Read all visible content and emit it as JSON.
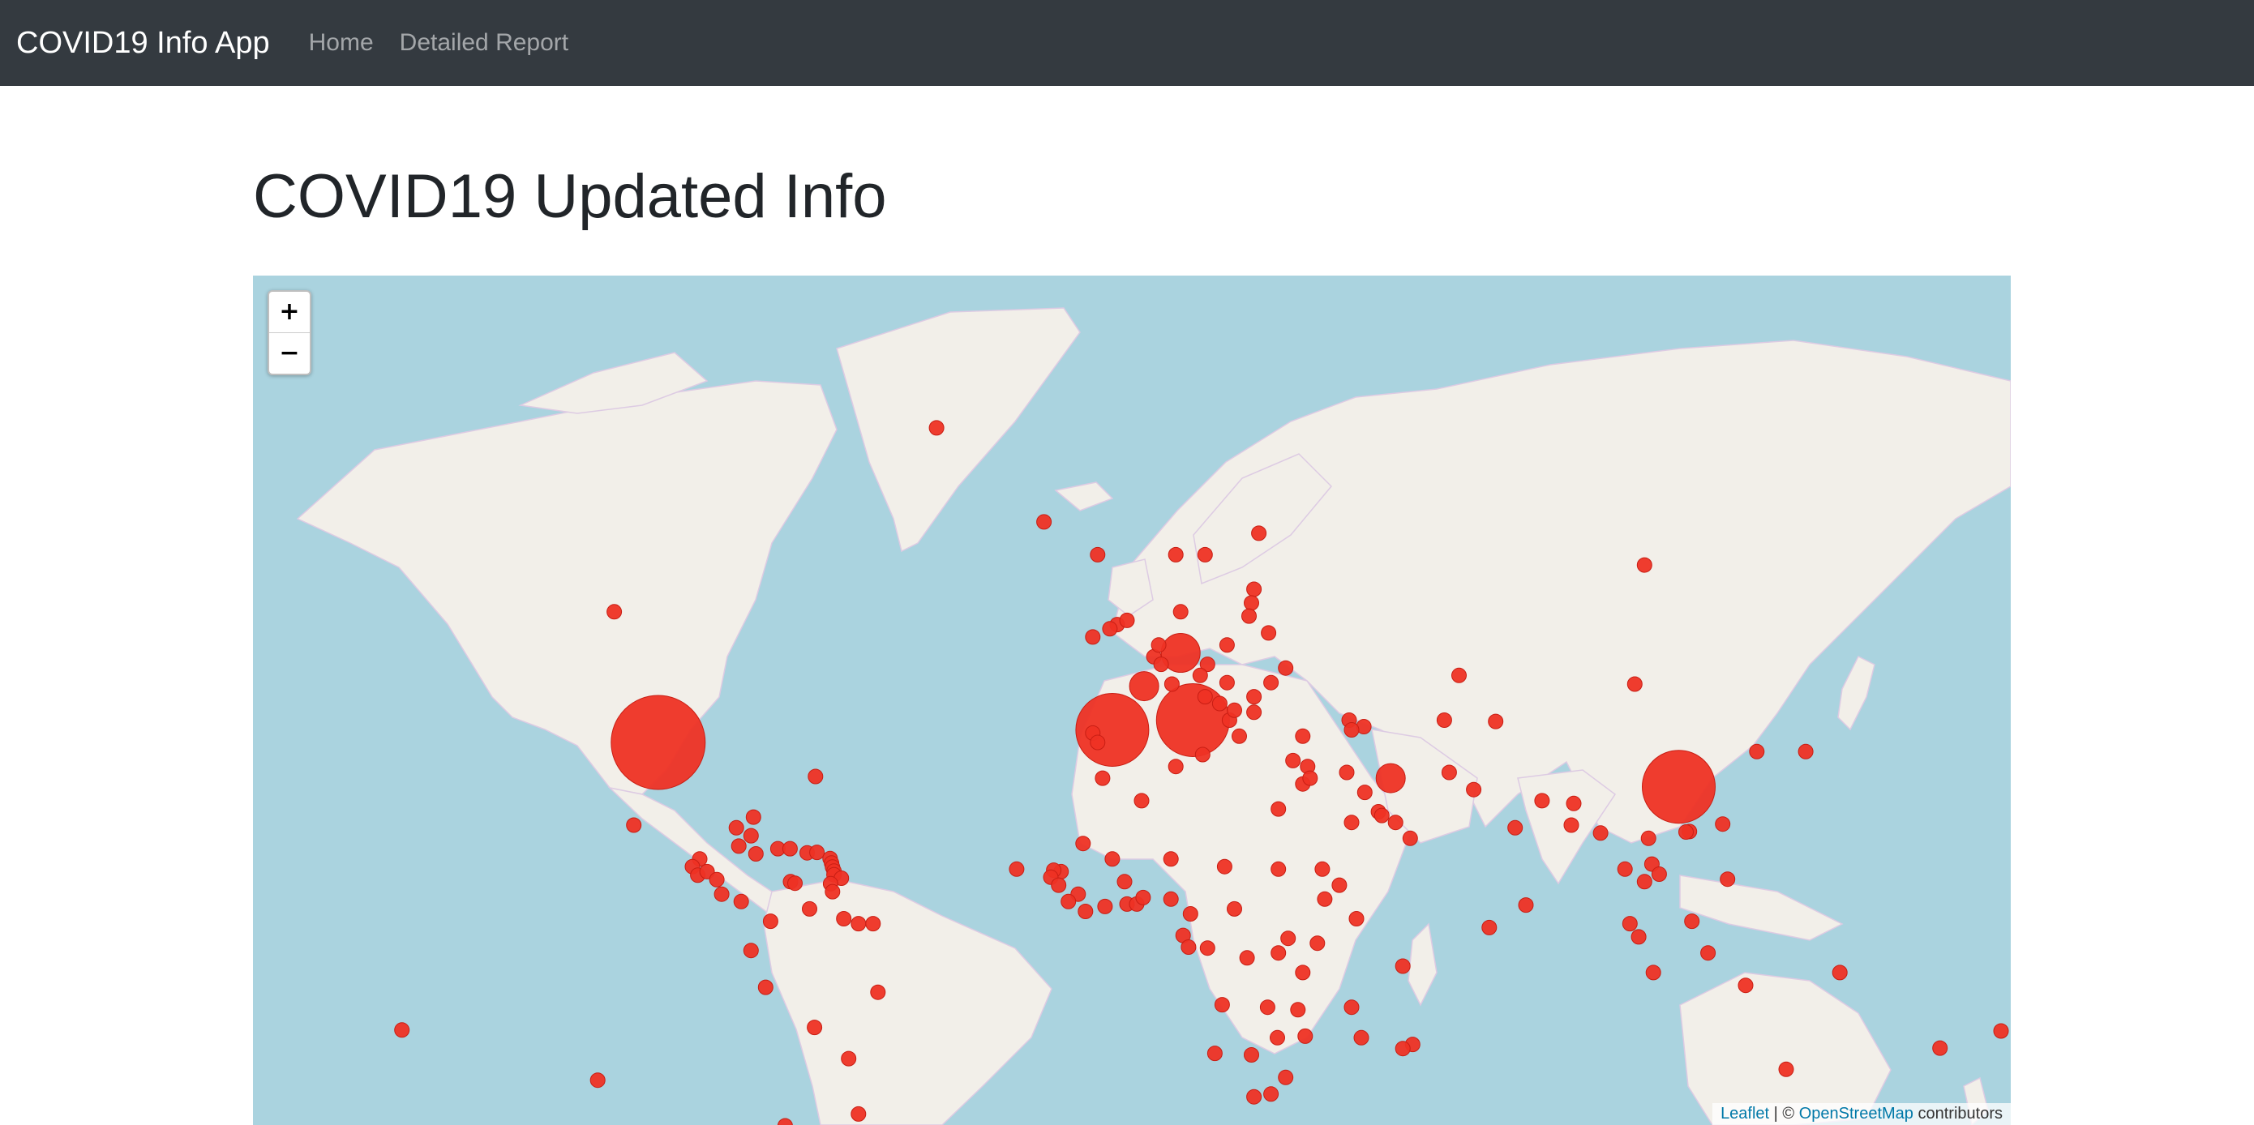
{
  "navbar": {
    "brand": "COVID19 Info App",
    "links": [
      "Home",
      "Detailed Report"
    ]
  },
  "page": {
    "title": "COVID19 Updated Info"
  },
  "map": {
    "zoom_in": "+",
    "zoom_out": "−",
    "attribution": {
      "leaflet": "Leaflet",
      "sep": " | © ",
      "osm": "OpenStreetMap",
      "suffix": " contributors"
    },
    "colors": {
      "water": "#aad3df",
      "land": "#f2efe9",
      "marker": "#ee3124",
      "marker_stroke": "#c81e14"
    },
    "markers": [
      {
        "lat": 38,
        "lon": -97,
        "size": "xl"
      },
      {
        "lat": 30.5,
        "lon": 112,
        "size": "l"
      },
      {
        "lat": 41.5,
        "lon": 12.5,
        "size": "l"
      },
      {
        "lat": 40,
        "lon": -4,
        "size": "l"
      },
      {
        "lat": 51,
        "lon": 10,
        "size": "m"
      },
      {
        "lat": 32,
        "lon": 53,
        "size": "s"
      },
      {
        "lat": 46.5,
        "lon": 2.5,
        "size": "s"
      },
      {
        "lat": 72,
        "lon": -40,
        "size": "xs"
      },
      {
        "lat": 65,
        "lon": -18,
        "size": "xs"
      },
      {
        "lat": 56,
        "lon": -106,
        "size": "xs"
      },
      {
        "lat": 61,
        "lon": 105,
        "size": "xs"
      },
      {
        "lat": 62,
        "lon": 9,
        "size": "xs"
      },
      {
        "lat": 62,
        "lon": 15,
        "size": "xs"
      },
      {
        "lat": 64,
        "lon": 26,
        "size": "xs"
      },
      {
        "lat": 58.5,
        "lon": 25,
        "size": "xs"
      },
      {
        "lat": 57,
        "lon": 24.5,
        "size": "xs"
      },
      {
        "lat": 55.5,
        "lon": 24,
        "size": "xs"
      },
      {
        "lat": 62,
        "lon": -7,
        "size": "xs"
      },
      {
        "lat": 53,
        "lon": -8,
        "size": "xs"
      },
      {
        "lat": 54.5,
        "lon": -3,
        "size": "xs"
      },
      {
        "lat": 55,
        "lon": -1,
        "size": "xs"
      },
      {
        "lat": 54,
        "lon": -4.5,
        "size": "xs"
      },
      {
        "lat": 56,
        "lon": 10,
        "size": "xs"
      },
      {
        "lat": 52,
        "lon": 19.5,
        "size": "xs"
      },
      {
        "lat": 53.5,
        "lon": 28,
        "size": "xs"
      },
      {
        "lat": 49,
        "lon": 31.5,
        "size": "xs"
      },
      {
        "lat": 47,
        "lon": 28.5,
        "size": "xs"
      },
      {
        "lat": 45,
        "lon": 25,
        "size": "xs"
      },
      {
        "lat": 42.7,
        "lon": 25,
        "size": "xs"
      },
      {
        "lat": 47,
        "lon": 19.5,
        "size": "xs"
      },
      {
        "lat": 49.5,
        "lon": 15.5,
        "size": "xs"
      },
      {
        "lat": 48,
        "lon": 14,
        "size": "xs"
      },
      {
        "lat": 50.5,
        "lon": 4.5,
        "size": "xs"
      },
      {
        "lat": 52,
        "lon": 5.5,
        "size": "xs"
      },
      {
        "lat": 49.5,
        "lon": 6,
        "size": "xs"
      },
      {
        "lat": 46.8,
        "lon": 8.2,
        "size": "xs"
      },
      {
        "lat": 39.5,
        "lon": -8,
        "size": "xs"
      },
      {
        "lat": 38,
        "lon": -7,
        "size": "xs"
      },
      {
        "lat": 36,
        "lon": 14.5,
        "size": "xs"
      },
      {
        "lat": 39,
        "lon": 22,
        "size": "xs"
      },
      {
        "lat": 41.5,
        "lon": 20,
        "size": "xs"
      },
      {
        "lat": 43,
        "lon": 21,
        "size": "xs"
      },
      {
        "lat": 45,
        "lon": 15,
        "size": "xs"
      },
      {
        "lat": 44,
        "lon": 18,
        "size": "xs"
      },
      {
        "lat": 39,
        "lon": 35,
        "size": "xs"
      },
      {
        "lat": 41.5,
        "lon": 44.5,
        "size": "xs"
      },
      {
        "lat": 40.5,
        "lon": 47.5,
        "size": "xs"
      },
      {
        "lat": 40,
        "lon": 45,
        "size": "xs"
      },
      {
        "lat": 35,
        "lon": 33,
        "size": "xs"
      },
      {
        "lat": 34,
        "lon": 36,
        "size": "xs"
      },
      {
        "lat": 31,
        "lon": 35,
        "size": "xs"
      },
      {
        "lat": 32,
        "lon": 36.5,
        "size": "xs"
      },
      {
        "lat": 33,
        "lon": 44,
        "size": "xs"
      },
      {
        "lat": 29.5,
        "lon": 47.7,
        "size": "xs"
      },
      {
        "lat": 26,
        "lon": 50.5,
        "size": "xs"
      },
      {
        "lat": 25.3,
        "lon": 51.2,
        "size": "xs"
      },
      {
        "lat": 24,
        "lon": 54,
        "size": "xs"
      },
      {
        "lat": 21,
        "lon": 57,
        "size": "xs"
      },
      {
        "lat": 24,
        "lon": 45,
        "size": "xs"
      },
      {
        "lat": 26.5,
        "lon": 30,
        "size": "xs"
      },
      {
        "lat": 34,
        "lon": 9,
        "size": "xs"
      },
      {
        "lat": 28,
        "lon": 2,
        "size": "xs"
      },
      {
        "lat": 32,
        "lon": -6,
        "size": "xs"
      },
      {
        "lat": 48,
        "lon": 67,
        "size": "xs"
      },
      {
        "lat": 41.5,
        "lon": 64,
        "size": "xs"
      },
      {
        "lat": 41.3,
        "lon": 74.5,
        "size": "xs"
      },
      {
        "lat": 33,
        "lon": 65,
        "size": "xs"
      },
      {
        "lat": 30,
        "lon": 70,
        "size": "xs"
      },
      {
        "lat": 23,
        "lon": 78.5,
        "size": "xs"
      },
      {
        "lat": 28,
        "lon": 84,
        "size": "xs"
      },
      {
        "lat": 27.5,
        "lon": 90.5,
        "size": "xs"
      },
      {
        "lat": 23.5,
        "lon": 90,
        "size": "xs"
      },
      {
        "lat": 22,
        "lon": 96,
        "size": "xs"
      },
      {
        "lat": 15,
        "lon": 101,
        "size": "xs"
      },
      {
        "lat": 12.5,
        "lon": 105,
        "size": "xs"
      },
      {
        "lat": 16,
        "lon": 106.5,
        "size": "xs"
      },
      {
        "lat": 21,
        "lon": 105.8,
        "size": "xs"
      },
      {
        "lat": 14,
        "lon": 108,
        "size": "xs"
      },
      {
        "lat": 22.3,
        "lon": 114.2,
        "size": "xs"
      },
      {
        "lat": 22.2,
        "lon": 113.5,
        "size": "xs"
      },
      {
        "lat": 23.7,
        "lon": 121,
        "size": "xs"
      },
      {
        "lat": 13,
        "lon": 122,
        "size": "xs"
      },
      {
        "lat": 36.5,
        "lon": 128,
        "size": "xs"
      },
      {
        "lat": 36.5,
        "lon": 138,
        "size": "xs"
      },
      {
        "lat": 46.8,
        "lon": 103,
        "size": "xs"
      },
      {
        "lat": 7.8,
        "lon": 80.7,
        "size": "xs"
      },
      {
        "lat": 3.2,
        "lon": 73.2,
        "size": "xs"
      },
      {
        "lat": 4,
        "lon": 102,
        "size": "xs"
      },
      {
        "lat": 1.3,
        "lon": 103.8,
        "size": "xs"
      },
      {
        "lat": 4.5,
        "lon": 114.7,
        "size": "xs"
      },
      {
        "lat": -2,
        "lon": 118,
        "size": "xs"
      },
      {
        "lat": -6,
        "lon": 106.8,
        "size": "xs"
      },
      {
        "lat": -8.6,
        "lon": 125.7,
        "size": "xs"
      },
      {
        "lat": -6,
        "lon": 145,
        "size": "xs"
      },
      {
        "lat": -25,
        "lon": 134,
        "size": "xs"
      },
      {
        "lat": -17.7,
        "lon": 178,
        "size": "xs"
      },
      {
        "lat": -21,
        "lon": 165.5,
        "size": "xs"
      },
      {
        "lat": -17.5,
        "lon": -149.5,
        "size": "xs"
      },
      {
        "lat": -20.3,
        "lon": 57.5,
        "size": "xs"
      },
      {
        "lat": -21.1,
        "lon": 55.5,
        "size": "xs"
      },
      {
        "lat": -4.7,
        "lon": 55.5,
        "size": "xs"
      },
      {
        "lat": -19,
        "lon": 47,
        "size": "xs"
      },
      {
        "lat": -13,
        "lon": 45,
        "size": "xs"
      },
      {
        "lat": -13.5,
        "lon": 34,
        "size": "xs"
      },
      {
        "lat": -6,
        "lon": 35,
        "size": "xs"
      },
      {
        "lat": -2,
        "lon": 30,
        "size": "xs"
      },
      {
        "lat": 1,
        "lon": 32,
        "size": "xs"
      },
      {
        "lat": 0,
        "lon": 38,
        "size": "xs"
      },
      {
        "lat": 9,
        "lon": 39.5,
        "size": "xs"
      },
      {
        "lat": 5,
        "lon": 46,
        "size": "xs"
      },
      {
        "lat": 11.8,
        "lon": 42.5,
        "size": "xs"
      },
      {
        "lat": 15,
        "lon": 39,
        "size": "xs"
      },
      {
        "lat": 15,
        "lon": 30,
        "size": "xs"
      },
      {
        "lat": 15.5,
        "lon": 19,
        "size": "xs"
      },
      {
        "lat": 17,
        "lon": 8,
        "size": "xs"
      },
      {
        "lat": 17,
        "lon": -4,
        "size": "xs"
      },
      {
        "lat": 20,
        "lon": -10,
        "size": "xs"
      },
      {
        "lat": 14.5,
        "lon": -14.5,
        "size": "xs"
      },
      {
        "lat": 14.8,
        "lon": -16,
        "size": "xs"
      },
      {
        "lat": 13.4,
        "lon": -16.6,
        "size": "xs"
      },
      {
        "lat": 11.8,
        "lon": -15,
        "size": "xs"
      },
      {
        "lat": 10,
        "lon": -11,
        "size": "xs"
      },
      {
        "lat": 8.5,
        "lon": -13,
        "size": "xs"
      },
      {
        "lat": 6.5,
        "lon": -9.5,
        "size": "xs"
      },
      {
        "lat": 7.5,
        "lon": -5.5,
        "size": "xs"
      },
      {
        "lat": 8,
        "lon": -1,
        "size": "xs"
      },
      {
        "lat": 8,
        "lon": 1,
        "size": "xs"
      },
      {
        "lat": 9.3,
        "lon": 2.3,
        "size": "xs"
      },
      {
        "lat": 12.5,
        "lon": -1.5,
        "size": "xs"
      },
      {
        "lat": 9,
        "lon": 8,
        "size": "xs"
      },
      {
        "lat": 6,
        "lon": 12,
        "size": "xs"
      },
      {
        "lat": 7,
        "lon": 21,
        "size": "xs"
      },
      {
        "lat": 1.6,
        "lon": 10.5,
        "size": "xs"
      },
      {
        "lat": -0.8,
        "lon": 11.6,
        "size": "xs"
      },
      {
        "lat": -1,
        "lon": 15.5,
        "size": "xs"
      },
      {
        "lat": -3,
        "lon": 23.6,
        "size": "xs"
      },
      {
        "lat": -12.5,
        "lon": 18.5,
        "size": "xs"
      },
      {
        "lat": -13,
        "lon": 27.8,
        "size": "xs"
      },
      {
        "lat": -19,
        "lon": 29.8,
        "size": "xs"
      },
      {
        "lat": -18.7,
        "lon": 35.5,
        "size": "xs"
      },
      {
        "lat": -22,
        "lon": 17,
        "size": "xs"
      },
      {
        "lat": -22.3,
        "lon": 24.5,
        "size": "xs"
      },
      {
        "lat": -26.5,
        "lon": 31.5,
        "size": "xs"
      },
      {
        "lat": -30,
        "lon": 25,
        "size": "xs"
      },
      {
        "lat": -29.5,
        "lon": 28.5,
        "size": "xs"
      },
      {
        "lat": 15,
        "lon": -23.6,
        "size": "xs"
      },
      {
        "lat": 32.3,
        "lon": -64.8,
        "size": "xs"
      },
      {
        "lat": 23.5,
        "lon": -102,
        "size": "xs"
      },
      {
        "lat": 23,
        "lon": -81,
        "size": "xs"
      },
      {
        "lat": 21.5,
        "lon": -78,
        "size": "xs"
      },
      {
        "lat": 25,
        "lon": -77.5,
        "size": "xs"
      },
      {
        "lat": 19.5,
        "lon": -80.5,
        "size": "xs"
      },
      {
        "lat": 18,
        "lon": -77,
        "size": "xs"
      },
      {
        "lat": 19,
        "lon": -72.5,
        "size": "xs"
      },
      {
        "lat": 19,
        "lon": -70,
        "size": "xs"
      },
      {
        "lat": 18.2,
        "lon": -66.5,
        "size": "xs"
      },
      {
        "lat": 18.3,
        "lon": -64.5,
        "size": "xs"
      },
      {
        "lat": 17.1,
        "lon": -61.8,
        "size": "xs"
      },
      {
        "lat": 16.2,
        "lon": -61.5,
        "size": "xs"
      },
      {
        "lat": 15.4,
        "lon": -61.3,
        "size": "xs"
      },
      {
        "lat": 14.6,
        "lon": -61,
        "size": "xs"
      },
      {
        "lat": 13.9,
        "lon": -61,
        "size": "xs"
      },
      {
        "lat": 13.2,
        "lon": -59.5,
        "size": "xs"
      },
      {
        "lat": 12.1,
        "lon": -61.7,
        "size": "xs"
      },
      {
        "lat": 10.5,
        "lon": -61.3,
        "size": "xs"
      },
      {
        "lat": 12.5,
        "lon": -69.9,
        "size": "xs"
      },
      {
        "lat": 12.2,
        "lon": -69,
        "size": "xs"
      },
      {
        "lat": 17,
        "lon": -88.5,
        "size": "xs"
      },
      {
        "lat": 15.5,
        "lon": -90,
        "size": "xs"
      },
      {
        "lat": 13.8,
        "lon": -88.9,
        "size": "xs"
      },
      {
        "lat": 14.5,
        "lon": -87,
        "size": "xs"
      },
      {
        "lat": 12.9,
        "lon": -85,
        "size": "xs"
      },
      {
        "lat": 10,
        "lon": -84,
        "size": "xs"
      },
      {
        "lat": 8.5,
        "lon": -80,
        "size": "xs"
      },
      {
        "lat": 7,
        "lon": -66,
        "size": "xs"
      },
      {
        "lat": 4.5,
        "lon": -74,
        "size": "xs"
      },
      {
        "lat": 5,
        "lon": -59,
        "size": "xs"
      },
      {
        "lat": 4,
        "lon": -56,
        "size": "xs"
      },
      {
        "lat": 4,
        "lon": -53,
        "size": "xs"
      },
      {
        "lat": -1.5,
        "lon": -78,
        "size": "xs"
      },
      {
        "lat": -9,
        "lon": -75,
        "size": "xs"
      },
      {
        "lat": -10,
        "lon": -52,
        "size": "xs"
      },
      {
        "lat": -17,
        "lon": -65,
        "size": "xs"
      },
      {
        "lat": -23,
        "lon": -58,
        "size": "xs"
      },
      {
        "lat": -35,
        "lon": -71,
        "size": "xs"
      },
      {
        "lat": -38,
        "lon": -65,
        "size": "xs"
      },
      {
        "lat": -33,
        "lon": -56,
        "size": "xs"
      },
      {
        "lat": -27,
        "lon": -109.4,
        "size": "xs"
      }
    ]
  }
}
